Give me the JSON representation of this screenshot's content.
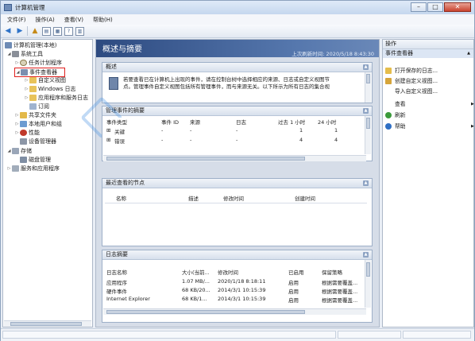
{
  "window": {
    "title": "计算机管理"
  },
  "menu": {
    "file": "文件(F)",
    "action": "操作(A)",
    "view": "查看(V)",
    "help": "帮助(H)"
  },
  "tree": {
    "root": "计算机管理(本地)",
    "system_tools": "系统工具",
    "task_scheduler": "任务计划程序",
    "event_viewer": "事件查看器",
    "custom_views": "自定义视图",
    "windows_logs": "Windows 日志",
    "app_service_logs": "应用程序和服务日志",
    "subscriptions": "订阅",
    "shared_folders": "共享文件夹",
    "local_users": "本地用户和组",
    "performance": "性能",
    "device_manager": "设备管理器",
    "storage": "存储",
    "disk_management": "磁盘管理",
    "services_apps": "服务和应用程序"
  },
  "center": {
    "banner_title": "概述与摘要",
    "last_refresh": "上次刷新时间: 2020/5/18 8:43:30",
    "overview": {
      "title": "概述",
      "text_line1": "若要查看已在计算机上出现的事件，请在控制台树中选择相应的来源、日志或自定义视图节",
      "text_line2": "点。管理事件自定义视图包括所有管理事件，而与来源无关。以下所示为所有日志的集合视"
    },
    "admin_summary": {
      "title": "管理事件的摘要",
      "headers": [
        "事件类型",
        "事件 ID",
        "来源",
        "日志",
        "过去 1 小时",
        "24 小时"
      ],
      "rows": [
        [
          "关键",
          "-",
          "-",
          "-",
          "1",
          "1"
        ],
        [
          "错误",
          "-",
          "-",
          "-",
          "4",
          "4"
        ]
      ]
    },
    "recent_nodes": {
      "title": "最近查看的节点",
      "headers": [
        "名称",
        "描述",
        "修改时间",
        "创建时间"
      ]
    },
    "log_summary": {
      "title": "日志摘要",
      "headers": [
        "日志名称",
        "大小(当前...",
        "修改时间",
        "已启用",
        "保留策略"
      ],
      "rows": [
        [
          "应用程序",
          "1.07 MB/...",
          "2020/1/18 8:18:11",
          "启用",
          "根据需要覆盖..."
        ],
        [
          "硬件事件",
          "68 KB/20...",
          "2014/3/1 10:15:39",
          "启用",
          "根据需要覆盖..."
        ],
        [
          "Internet Explorer",
          "68 KB/1...",
          "2014/3/1 10:15:39",
          "启用",
          "根据需要覆盖..."
        ]
      ]
    }
  },
  "actions": {
    "title": "操作",
    "section": "事件查看器",
    "items": [
      "打开保存的日志...",
      "创建自定义视图...",
      "导入自定义视图...",
      "查看",
      "刷新",
      "帮助"
    ]
  },
  "colors": {
    "highlight_box": "#e0201e",
    "banner": "#2d4a80"
  }
}
